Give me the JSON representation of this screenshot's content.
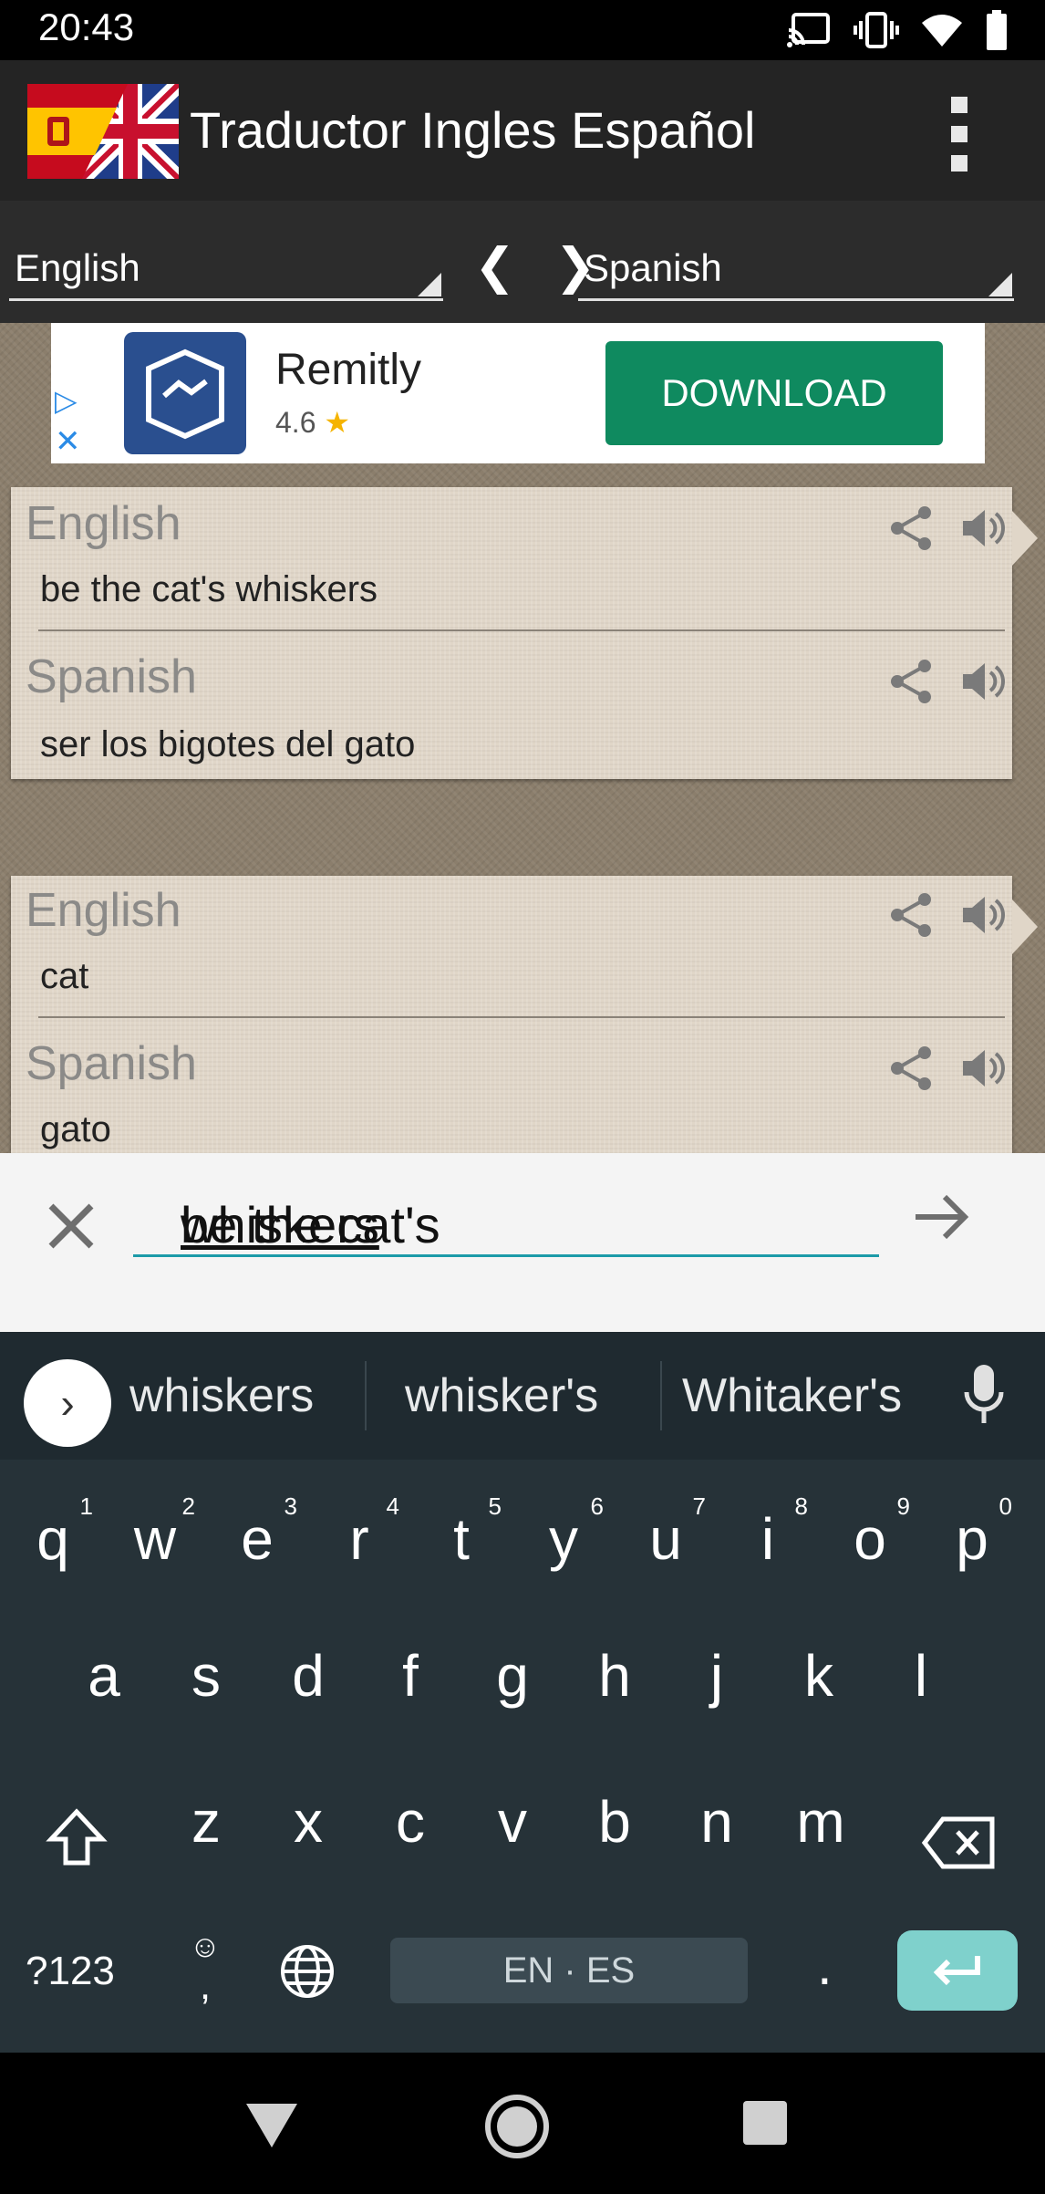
{
  "status_bar": {
    "time": "20:43"
  },
  "app_bar": {
    "title": "Traductor Ingles Español"
  },
  "language_bar": {
    "source": "English",
    "target": "Spanish",
    "swap_symbol": "❮ ❯"
  },
  "ad": {
    "name": "Remitly",
    "rating": "4.6",
    "star": "★",
    "cta": "DOWNLOAD",
    "play_symbol": "▷",
    "close_symbol": "✕"
  },
  "cards": [
    {
      "source_lang": "English",
      "source_text": "be the cat's whiskers",
      "target_lang": "Spanish",
      "target_text": "ser los bigotes del gato"
    },
    {
      "source_lang": "English",
      "source_text": "cat",
      "target_lang": "Spanish",
      "target_text": "gato"
    }
  ],
  "input": {
    "value": "be the cat's whiskers",
    "prefix": "be the cat's ",
    "underlined": "whiskers"
  },
  "keyboard": {
    "expand_symbol": "›",
    "suggestions": [
      "whiskers",
      "whisker's",
      "Whitaker's"
    ],
    "row1": [
      "q",
      "w",
      "e",
      "r",
      "t",
      "y",
      "u",
      "i",
      "o",
      "p"
    ],
    "row1_numbers": [
      "1",
      "2",
      "3",
      "4",
      "5",
      "6",
      "7",
      "8",
      "9",
      "0"
    ],
    "row2": [
      "a",
      "s",
      "d",
      "f",
      "g",
      "h",
      "j",
      "k",
      "l"
    ],
    "row3": [
      "z",
      "x",
      "c",
      "v",
      "b",
      "n",
      "m"
    ],
    "symbols_key": "?123",
    "comma_key": ",",
    "emoji_key": "☺",
    "space_label": "EN · ES",
    "period_key": "."
  },
  "colors": {
    "ad_cta": "#0f8a5f",
    "input_underline": "#1b9aa8",
    "enter_key": "#7fd1cc",
    "keyboard_bg": "#263238"
  }
}
